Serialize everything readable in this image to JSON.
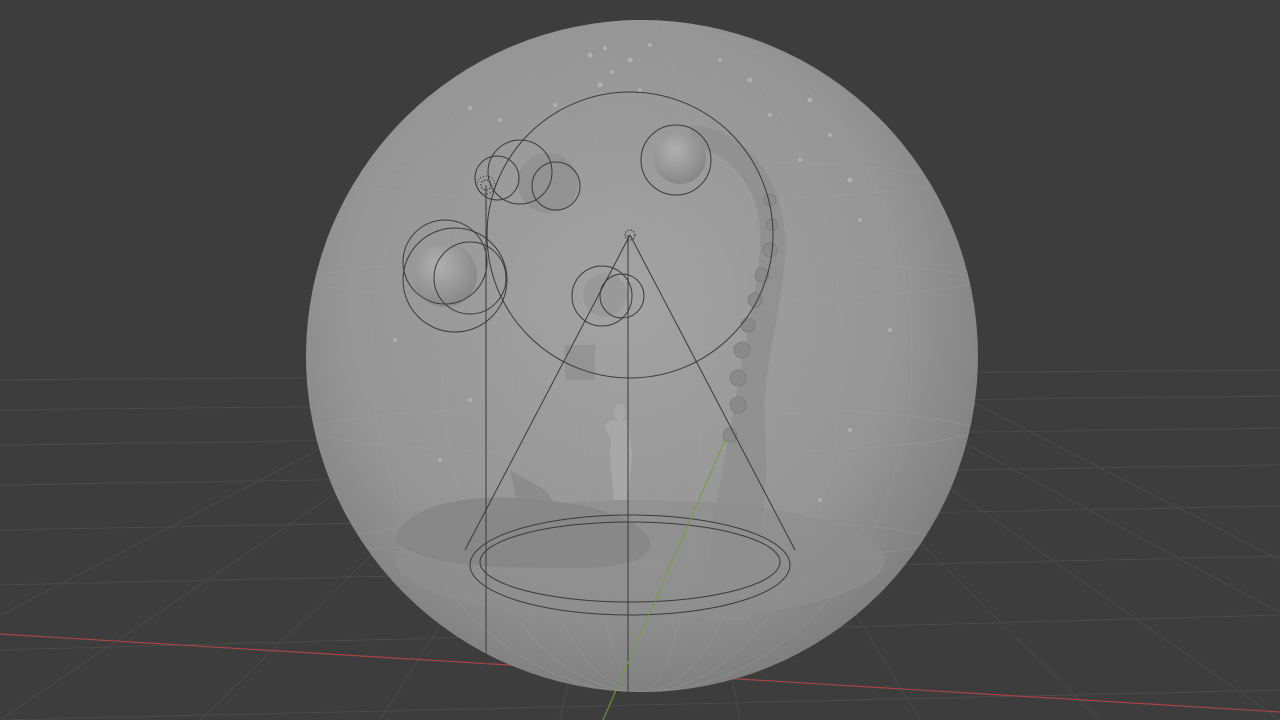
{
  "viewport": {
    "background_color": "#3d3d3d",
    "grid_color": "#4a4a4a",
    "x_axis_color": "#a84545",
    "y_axis_color": "#7a9b3a",
    "sphere_color": "#9a9a9a",
    "gizmo_color": "#3a3a3a"
  },
  "scene_objects": [
    {
      "name": "glass-sphere",
      "kind": "mesh"
    },
    {
      "name": "spot-light-cone",
      "kind": "light"
    },
    {
      "name": "figure-statue",
      "kind": "mesh"
    },
    {
      "name": "tentacle",
      "kind": "mesh"
    },
    {
      "name": "bathtub",
      "kind": "mesh"
    },
    {
      "name": "floating-orbs",
      "kind": "mesh"
    }
  ]
}
